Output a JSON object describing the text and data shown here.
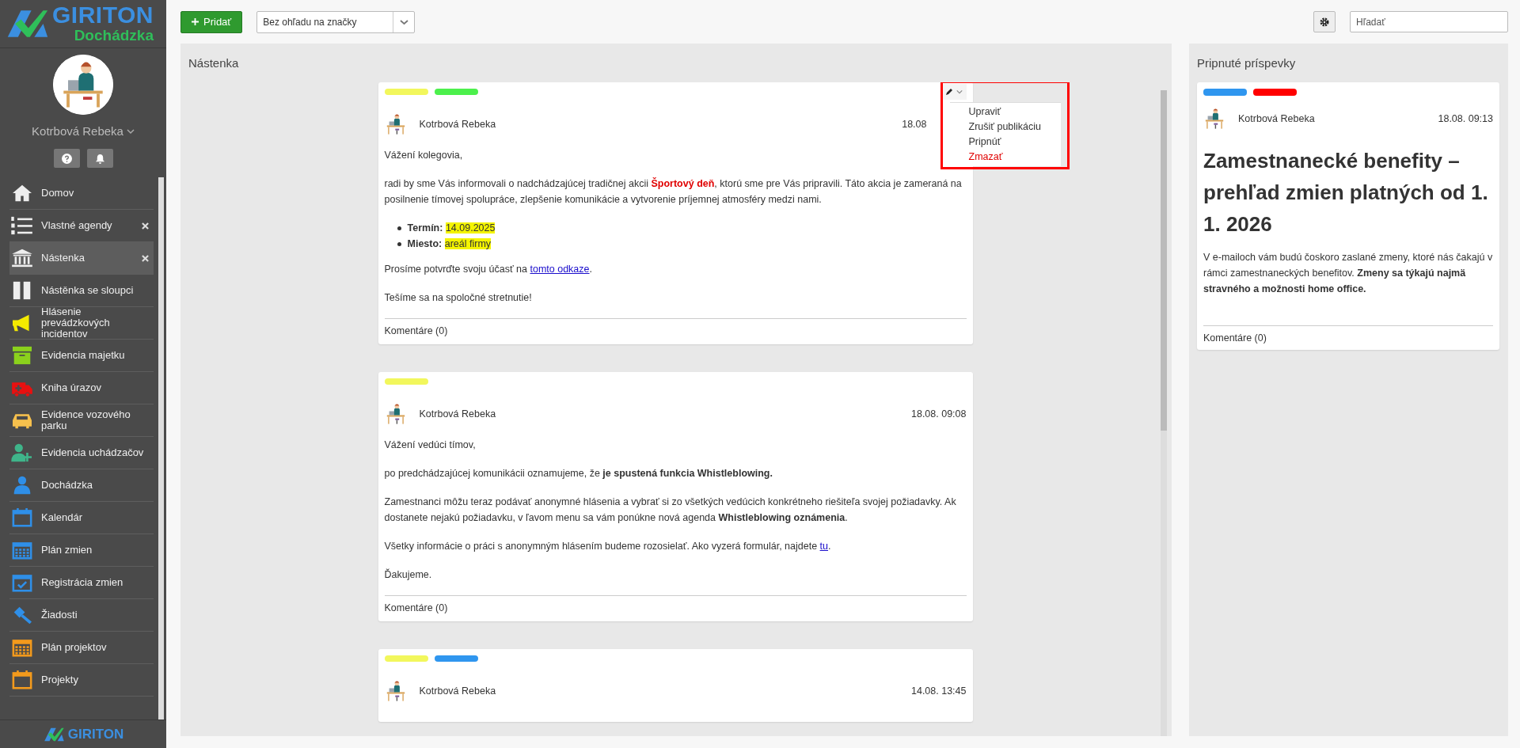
{
  "sidebar": {
    "logo": {
      "brand": "GIRITON",
      "product": "Dochádzka"
    },
    "user": {
      "name": "Kotrbová Rebeka"
    },
    "nav": [
      {
        "label": "Domov",
        "selected": false,
        "closable": false
      },
      {
        "label": "Vlastné agendy",
        "selected": false,
        "closable": true
      },
      {
        "label": "Nástenka",
        "selected": true,
        "closable": true
      },
      {
        "label": "Nástěnka se sloupci",
        "selected": false,
        "closable": false
      },
      {
        "label": "Hlásenie prevádzkových incidentov",
        "selected": false,
        "closable": false
      },
      {
        "label": "Evidencia majetku",
        "selected": false,
        "closable": false
      },
      {
        "label": "Kniha úrazov",
        "selected": false,
        "closable": false
      },
      {
        "label": "Evidence vozového parku",
        "selected": false,
        "closable": false
      },
      {
        "label": "Evidencia uchádzačov",
        "selected": false,
        "closable": false
      },
      {
        "label": "Dochádzka",
        "selected": false,
        "closable": false
      },
      {
        "label": "Kalendár",
        "selected": false,
        "closable": false
      },
      {
        "label": "Plán zmien",
        "selected": false,
        "closable": false
      },
      {
        "label": "Registrácia zmien",
        "selected": false,
        "closable": false
      },
      {
        "label": "Žiadosti",
        "selected": false,
        "closable": false
      },
      {
        "label": "Plán projektov",
        "selected": false,
        "closable": false
      },
      {
        "label": "Projekty",
        "selected": false,
        "closable": false
      }
    ],
    "footer_logo": "GIRITON"
  },
  "toolbar": {
    "add_button": "Pridať",
    "tag_filter": "Bez ohľadu na značky",
    "search": {
      "placeholder": "Hľadať"
    }
  },
  "board": {
    "title": "Nástenka",
    "posts": [
      {
        "tags": [
          {
            "color": "#f2f75c"
          },
          {
            "color": "#4cf04c"
          }
        ],
        "author": "Kotrbová Rebeka",
        "date": "18.08",
        "menu": {
          "open": true,
          "highlighted": true,
          "items": [
            {
              "label": "Upraviť",
              "kind": "normal"
            },
            {
              "label": "Zrušiť publikáciu",
              "kind": "normal"
            },
            {
              "label": "Pripnúť",
              "kind": "normal"
            },
            {
              "label": "Zmazať",
              "kind": "danger"
            }
          ]
        },
        "body": [
          {
            "kind": "p",
            "parts": [
              {
                "kind": "plain",
                "text": "Vážení kolegovia,"
              }
            ]
          },
          {
            "kind": "p",
            "parts": [
              {
                "kind": "plain",
                "text": "radi by sme Vás informovali o nadchádzajúcej tradičnej akcii "
              },
              {
                "kind": "alert",
                "text": "Športový deň"
              },
              {
                "kind": "plain",
                "text": ", ktorú sme pre Vás pripravili. Táto akcia je zameraná na posilnenie tímovej spolupráce, zlepšenie komunikácie a vytvorenie príjemnej atmosféry medzi nami."
              }
            ]
          },
          {
            "kind": "list",
            "items": [
              [
                {
                  "kind": "bold",
                  "text": "Termín: "
                },
                {
                  "kind": "mark",
                  "text": "14.09.2025"
                }
              ],
              [
                {
                  "kind": "bold",
                  "text": "Miesto: "
                },
                {
                  "kind": "mark",
                  "text": "areál firmy"
                }
              ]
            ]
          },
          {
            "kind": "p",
            "parts": [
              {
                "kind": "plain",
                "text": "Prosíme potvrďte svoju účasť na "
              },
              {
                "kind": "link",
                "text": "tomto odkaze"
              },
              {
                "kind": "plain",
                "text": "."
              }
            ]
          },
          {
            "kind": "p",
            "parts": [
              {
                "kind": "plain",
                "text": "Tešíme sa na spoločné stretnutie!"
              }
            ]
          }
        ],
        "comments": "Komentáre (0)"
      },
      {
        "tags": [
          {
            "color": "#f2f75c"
          }
        ],
        "author": "Kotrbová Rebeka",
        "date": "18.08. 09:08",
        "body": [
          {
            "kind": "p",
            "parts": [
              {
                "kind": "plain",
                "text": "Vážení vedúci tímov,"
              }
            ]
          },
          {
            "kind": "p",
            "parts": [
              {
                "kind": "plain",
                "text": "po predchádzajúcej komunikácii oznamujeme, že "
              },
              {
                "kind": "bold",
                "text": "je spustená funkcia Whistleblowing."
              }
            ]
          },
          {
            "kind": "p",
            "parts": [
              {
                "kind": "plain",
                "text": "Zamestnanci môžu teraz podávať anonymné hlásenia a vybrať si zo všetkých vedúcich konkrétneho riešiteľa svojej požiadavky. Ak dostanete nejakú požiadavku, v ľavom menu sa vám ponúkne nová agenda "
              },
              {
                "kind": "bold",
                "text": "Whistleblowing oznámenia"
              },
              {
                "kind": "plain",
                "text": "."
              }
            ]
          },
          {
            "kind": "p",
            "parts": [
              {
                "kind": "plain",
                "text": "Všetky informácie o práci s anonymným hlásením budeme rozosielať. Ako vyzerá formulár, najdete "
              },
              {
                "kind": "link",
                "text": "tu"
              },
              {
                "kind": "plain",
                "text": "."
              }
            ]
          },
          {
            "kind": "p",
            "parts": [
              {
                "kind": "plain",
                "text": "Ďakujeme."
              }
            ]
          }
        ],
        "comments": "Komentáre (0)"
      },
      {
        "tags": [
          {
            "color": "#f2f75c"
          },
          {
            "color": "#2f96ef"
          }
        ],
        "author": "Kotrbová Rebeka",
        "date": "14.08. 13:45"
      }
    ]
  },
  "pinned": {
    "title": "Pripnuté príspevky",
    "posts": [
      {
        "tags": [
          {
            "color": "#2f96ef"
          },
          {
            "color": "#ff0000"
          }
        ],
        "author": "Kotrbová Rebeka",
        "date": "18.08. 09:13",
        "body": [
          {
            "kind": "heading",
            "parts": [
              {
                "kind": "plain",
                "text": "Zamestnanecké benefity – prehľad zmien platných od 1. 1. 2026"
              }
            ]
          },
          {
            "kind": "p",
            "parts": [
              {
                "kind": "plain",
                "text": "V e-mailoch vám budú čoskoro zaslané zmeny, ktoré nás čakajú v rámci zamestnaneckých benefitov. "
              },
              {
                "kind": "bold",
                "text": "Zmeny sa týkajú najmä stravného a možnosti home office."
              }
            ]
          }
        ],
        "comments": "Komentáre (0)"
      }
    ]
  }
}
